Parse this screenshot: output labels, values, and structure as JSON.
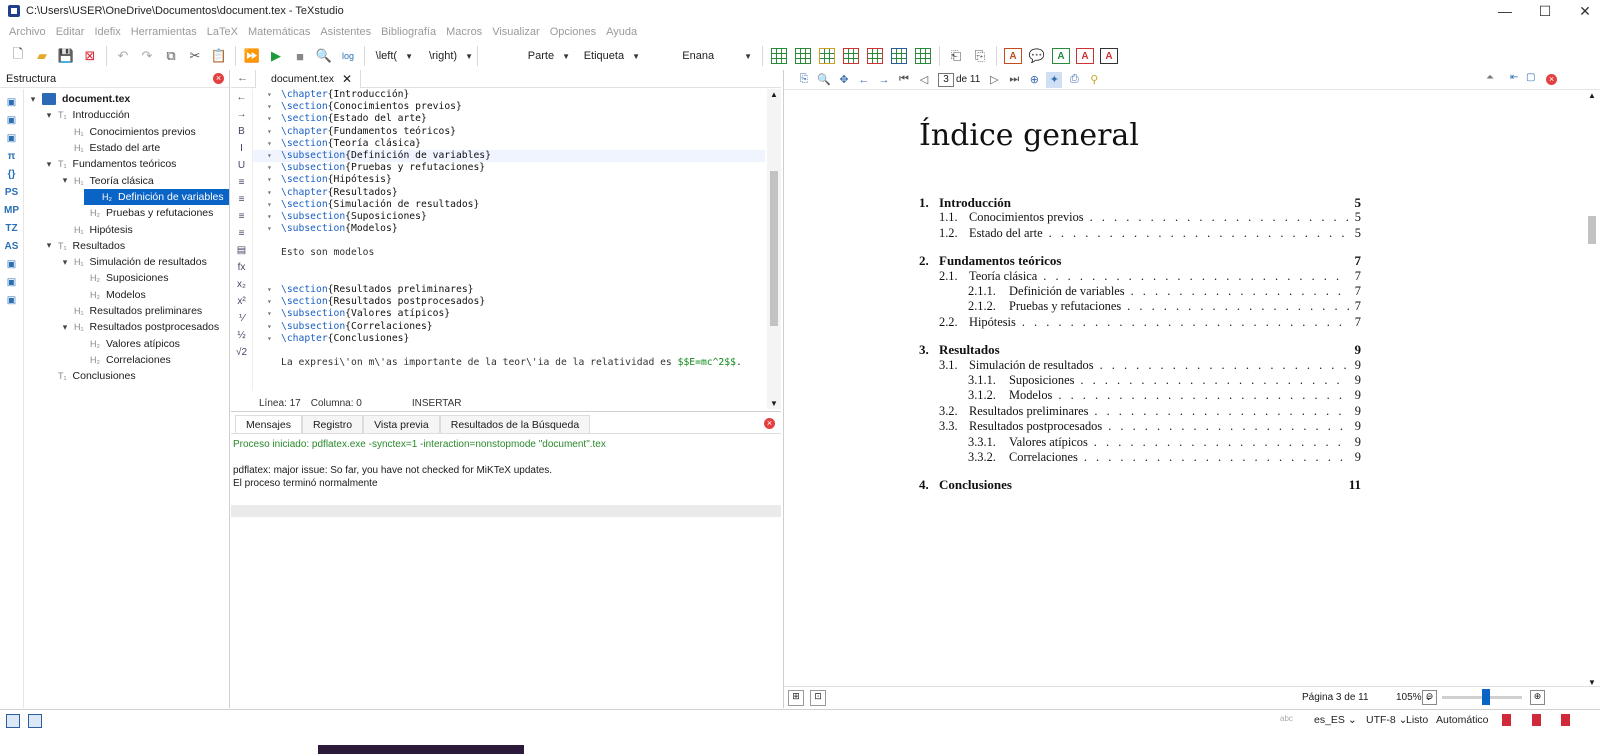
{
  "window": {
    "title": "C:\\Users\\USER\\OneDrive\\Documentos\\document.tex - TeXstudio",
    "controls": [
      "—",
      "☐",
      "✕"
    ]
  },
  "menubar": [
    "Archivo",
    "Editar",
    "Idefix",
    "Herramientas",
    "LaTeX",
    "Matemáticas",
    "Asistentes",
    "Bibliografía",
    "Macros",
    "Visualizar",
    "Opciones",
    "Ayuda"
  ],
  "toolbar": {
    "left_delim": "\\left(",
    "right_delim": "\\right)",
    "part": "Parte",
    "label": "Etiqueta",
    "size": "Enana",
    "log_label": "log"
  },
  "structure": {
    "header": "Estructura",
    "side_icons": [
      "structure",
      "outline",
      "bookmark",
      "π",
      "{}",
      "PS",
      "MP",
      "TZ",
      "AS",
      "table",
      "chart",
      "bookmark2"
    ],
    "side_labels": [
      "",
      "",
      "",
      "π",
      "{}",
      "PS",
      "MP",
      "TZ",
      "AS",
      "",
      "",
      ""
    ],
    "tree": [
      {
        "indent": 0,
        "caret": "▾",
        "kind": "",
        "label": "document.tex",
        "root": true
      },
      {
        "indent": 1,
        "caret": "▾",
        "kind": "T₁",
        "label": "Introducción"
      },
      {
        "indent": 2,
        "caret": "",
        "kind": "H₁",
        "label": "Conocimientos previos"
      },
      {
        "indent": 2,
        "caret": "",
        "kind": "H₁",
        "label": "Estado del arte"
      },
      {
        "indent": 1,
        "caret": "▾",
        "kind": "T₁",
        "label": "Fundamentos teóricos"
      },
      {
        "indent": 2,
        "caret": "▾",
        "kind": "H₁",
        "label": "Teoría clásica"
      },
      {
        "indent": 3,
        "caret": "",
        "kind": "H₂",
        "label": "Definición de variables",
        "selected": true
      },
      {
        "indent": 3,
        "caret": "",
        "kind": "H₂",
        "label": "Pruebas y refutaciones"
      },
      {
        "indent": 2,
        "caret": "",
        "kind": "H₁",
        "label": "Hipótesis"
      },
      {
        "indent": 1,
        "caret": "▾",
        "kind": "T₁",
        "label": "Resultados"
      },
      {
        "indent": 2,
        "caret": "▾",
        "kind": "H₁",
        "label": "Simulación de resultados"
      },
      {
        "indent": 3,
        "caret": "",
        "kind": "H₂",
        "label": "Suposiciones"
      },
      {
        "indent": 3,
        "caret": "",
        "kind": "H₂",
        "label": "Modelos"
      },
      {
        "indent": 2,
        "caret": "",
        "kind": "H₁",
        "label": "Resultados preliminares"
      },
      {
        "indent": 2,
        "caret": "▾",
        "kind": "H₁",
        "label": "Resultados postprocesados"
      },
      {
        "indent": 3,
        "caret": "",
        "kind": "H₂",
        "label": "Valores atípicos"
      },
      {
        "indent": 3,
        "caret": "",
        "kind": "H₂",
        "label": "Correlaciones"
      },
      {
        "indent": 1,
        "caret": "",
        "kind": "T₁",
        "label": "Conclusiones"
      }
    ]
  },
  "editor": {
    "tab": "document.tex",
    "gutter": [
      "←",
      "→",
      "B",
      "I",
      "U",
      "≡",
      "≡",
      "≡",
      "≡",
      "▤",
      "fx",
      "x₂",
      "x²",
      "⅟",
      "½",
      "√2"
    ],
    "lines": [
      {
        "fold": "▾",
        "cmd": "\\chapter",
        "arg": "{Introducción}"
      },
      {
        "fold": "▾",
        "cmd": "\\section",
        "arg": "{Conocimientos previos}"
      },
      {
        "fold": "▾",
        "cmd": "\\section",
        "arg": "{Estado del arte}"
      },
      {
        "fold": "▾",
        "cmd": "\\chapter",
        "arg": "{Fundamentos teóricos}"
      },
      {
        "fold": "▾",
        "cmd": "\\section",
        "arg": "{Teoría clásica}"
      },
      {
        "fold": "▾",
        "cmd": "\\subsection",
        "arg": "{Definición de variables}",
        "active": true
      },
      {
        "fold": "▾",
        "cmd": "\\subsection",
        "arg": "{Pruebas y refutaciones}"
      },
      {
        "fold": "▾",
        "cmd": "\\section",
        "arg": "{Hipótesis}"
      },
      {
        "fold": "▾",
        "cmd": "\\chapter",
        "arg": "{Resultados}"
      },
      {
        "fold": "▾",
        "cmd": "\\section",
        "arg": "{Simulación de resultados}"
      },
      {
        "fold": "▾",
        "cmd": "\\subsection",
        "arg": "{Suposiciones}"
      },
      {
        "fold": "▾",
        "cmd": "\\subsection",
        "arg": "{Modelos}"
      },
      {
        "fold": "",
        "cmd": "",
        "arg": ""
      },
      {
        "fold": "",
        "cmd": "",
        "arg": "",
        "plain": "Esto son modelos"
      },
      {
        "fold": "",
        "cmd": "",
        "arg": ""
      },
      {
        "fold": "",
        "cmd": "",
        "arg": ""
      },
      {
        "fold": "▾",
        "cmd": "\\section",
        "arg": "{Resultados preliminares}"
      },
      {
        "fold": "▾",
        "cmd": "\\section",
        "arg": "{Resultados postprocesados}"
      },
      {
        "fold": "▾",
        "cmd": "\\subsection",
        "arg": "{Valores atípicos}"
      },
      {
        "fold": "▾",
        "cmd": "\\subsection",
        "arg": "{Correlaciones}"
      },
      {
        "fold": "▾",
        "cmd": "\\chapter",
        "arg": "{Conclusiones}"
      },
      {
        "fold": "",
        "cmd": "",
        "arg": ""
      },
      {
        "fold": "",
        "cmd": "",
        "arg": "",
        "plain": "La expresi\\'on m\\'as importante de la teor\\'ia de la relatividad es ",
        "math": "$$E=mc^2$$",
        "tail": "."
      }
    ],
    "status": {
      "line": "Línea: 17",
      "column": "Columna: 0",
      "mode": "INSERTAR"
    }
  },
  "messages": {
    "tabs": [
      "Mensajes",
      "Registro",
      "Vista previa",
      "Resultados de la Búsqueda"
    ],
    "active_tab": 0,
    "lines": [
      {
        "text": "Proceso iniciado: pdflatex.exe -synctex=1 -interaction=nonstopmode \"document\".tex",
        "color": "green"
      },
      {
        "text": "",
        "color": "plain"
      },
      {
        "text": "pdflatex: major issue: So far, you have not checked for MiKTeX updates.",
        "color": "plain"
      },
      {
        "text": "El proceso terminó normalmente",
        "color": "plain"
      }
    ]
  },
  "viewer": {
    "page_current": "3",
    "page_total": "de 11",
    "toc_title": "Índice general",
    "toc": [
      {
        "level": 0,
        "num": "1.",
        "title": "Introducción",
        "page": "5"
      },
      {
        "level": 1,
        "num": "1.1.",
        "title": "Conocimientos previos",
        "page": "5"
      },
      {
        "level": 1,
        "num": "1.2.",
        "title": "Estado del arte",
        "page": "5"
      },
      {
        "level": 0,
        "num": "2.",
        "title": "Fundamentos teóricos",
        "page": "7"
      },
      {
        "level": 1,
        "num": "2.1.",
        "title": "Teoría clásica",
        "page": "7"
      },
      {
        "level": 2,
        "num": "2.1.1.",
        "title": "Definición de variables",
        "page": "7"
      },
      {
        "level": 2,
        "num": "2.1.2.",
        "title": "Pruebas y refutaciones",
        "page": "7"
      },
      {
        "level": 1,
        "num": "2.2.",
        "title": "Hipótesis",
        "page": "7"
      },
      {
        "level": 0,
        "num": "3.",
        "title": "Resultados",
        "page": "9"
      },
      {
        "level": 1,
        "num": "3.1.",
        "title": "Simulación de resultados",
        "page": "9"
      },
      {
        "level": 2,
        "num": "3.1.1.",
        "title": "Suposiciones",
        "page": "9"
      },
      {
        "level": 2,
        "num": "3.1.2.",
        "title": "Modelos",
        "page": "9"
      },
      {
        "level": 1,
        "num": "3.2.",
        "title": "Resultados preliminares",
        "page": "9"
      },
      {
        "level": 1,
        "num": "3.3.",
        "title": "Resultados postprocesados",
        "page": "9"
      },
      {
        "level": 2,
        "num": "3.3.1.",
        "title": "Valores atípicos",
        "page": "9"
      },
      {
        "level": 2,
        "num": "3.3.2.",
        "title": "Correlaciones",
        "page": "9"
      },
      {
        "level": 0,
        "num": "4.",
        "title": "Conclusiones",
        "page": "11"
      }
    ],
    "status_page": "Página 3 de 11",
    "zoom": "105%"
  },
  "statusbar": {
    "spell": "abc",
    "language": "es_ES",
    "encoding": "UTF-8",
    "state": "Listo",
    "compile": "Automático"
  },
  "colors": {
    "accent": "#0a64c6",
    "latex_command": "#1a5fc2",
    "math": "#0f8a1a",
    "close_red": "#e34040"
  }
}
